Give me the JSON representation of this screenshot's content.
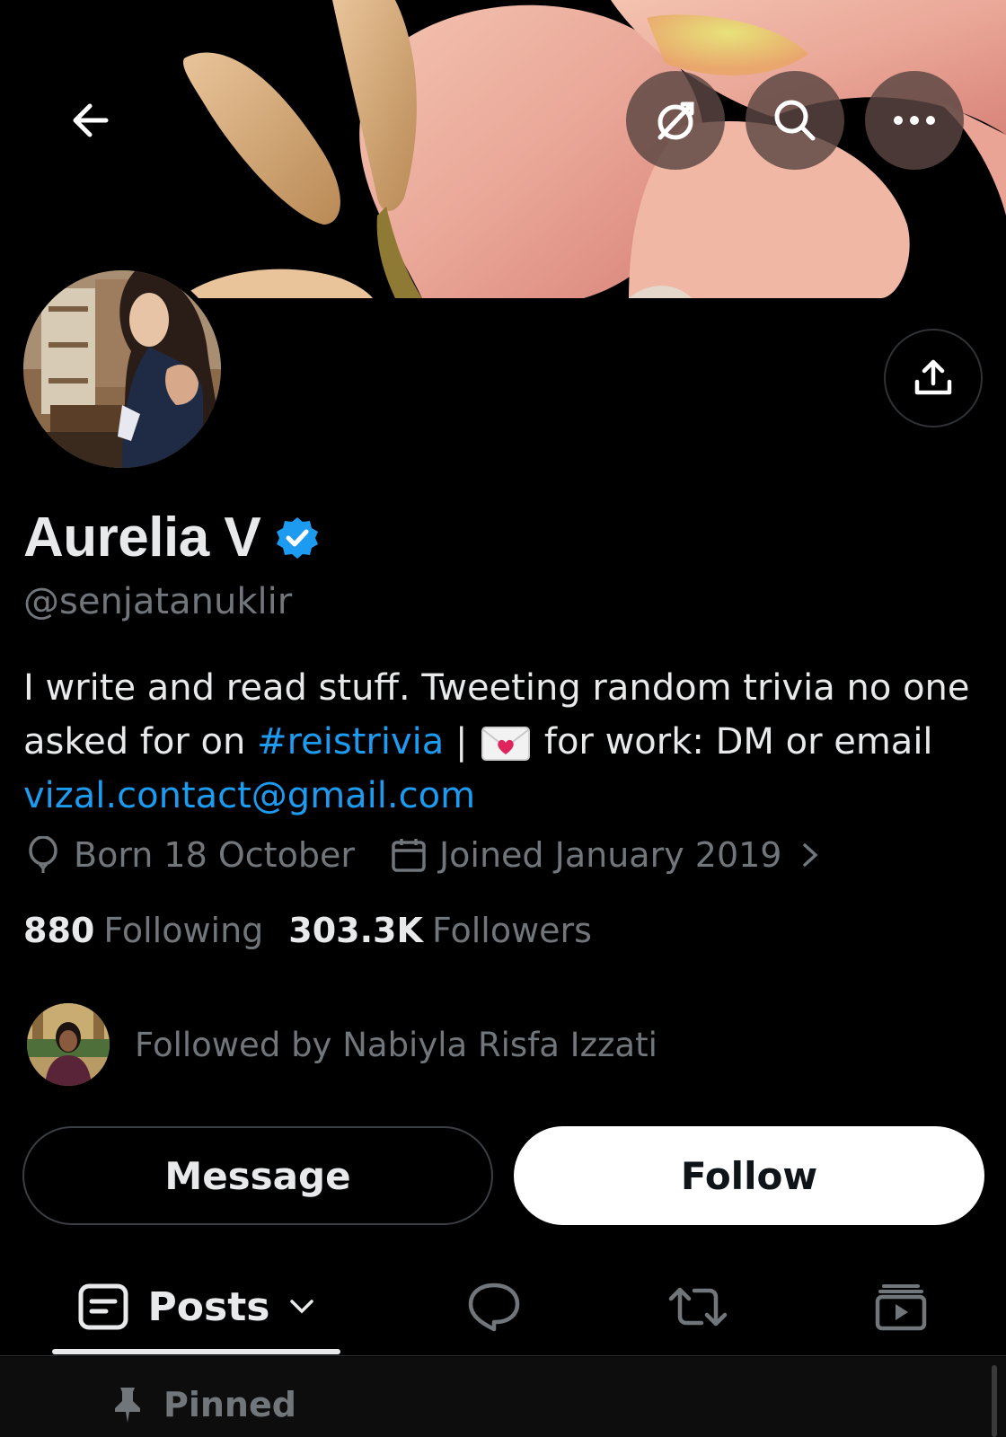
{
  "header": {
    "back_icon": "arrow-left-icon",
    "grok_icon": "grok-icon",
    "search_icon": "search-icon",
    "more_icon": "more-horizontal-icon"
  },
  "profile": {
    "name": "Aurelia V",
    "verified": true,
    "handle": "@senjatanuklir",
    "bio": {
      "part1": "I write and read stuff. Tweeting random trivia no one asked for on ",
      "hashtag": "#reistrivia",
      "part2": " | ",
      "part3": " for work: DM or email ",
      "email": "vizal.contact@gmail.com"
    },
    "born": "Born 18 October",
    "joined": "Joined January 2019",
    "following_count": "880",
    "following_label": "Following",
    "followers_count": "303.3K",
    "followers_label": "Followers",
    "followed_by": "Followed by Nabiyla Risfa Izzati"
  },
  "actions": {
    "message_label": "Message",
    "follow_label": "Follow",
    "share_icon": "share-icon"
  },
  "tabs": {
    "posts_label": "Posts",
    "replies_icon": "reply-icon",
    "reposts_icon": "repost-icon",
    "media_icon": "media-icon"
  },
  "pinned": {
    "label": "Pinned"
  },
  "colors": {
    "accent": "#1d9bf0",
    "muted": "#71767b",
    "text": "#e7e9ea",
    "background": "#000000"
  }
}
